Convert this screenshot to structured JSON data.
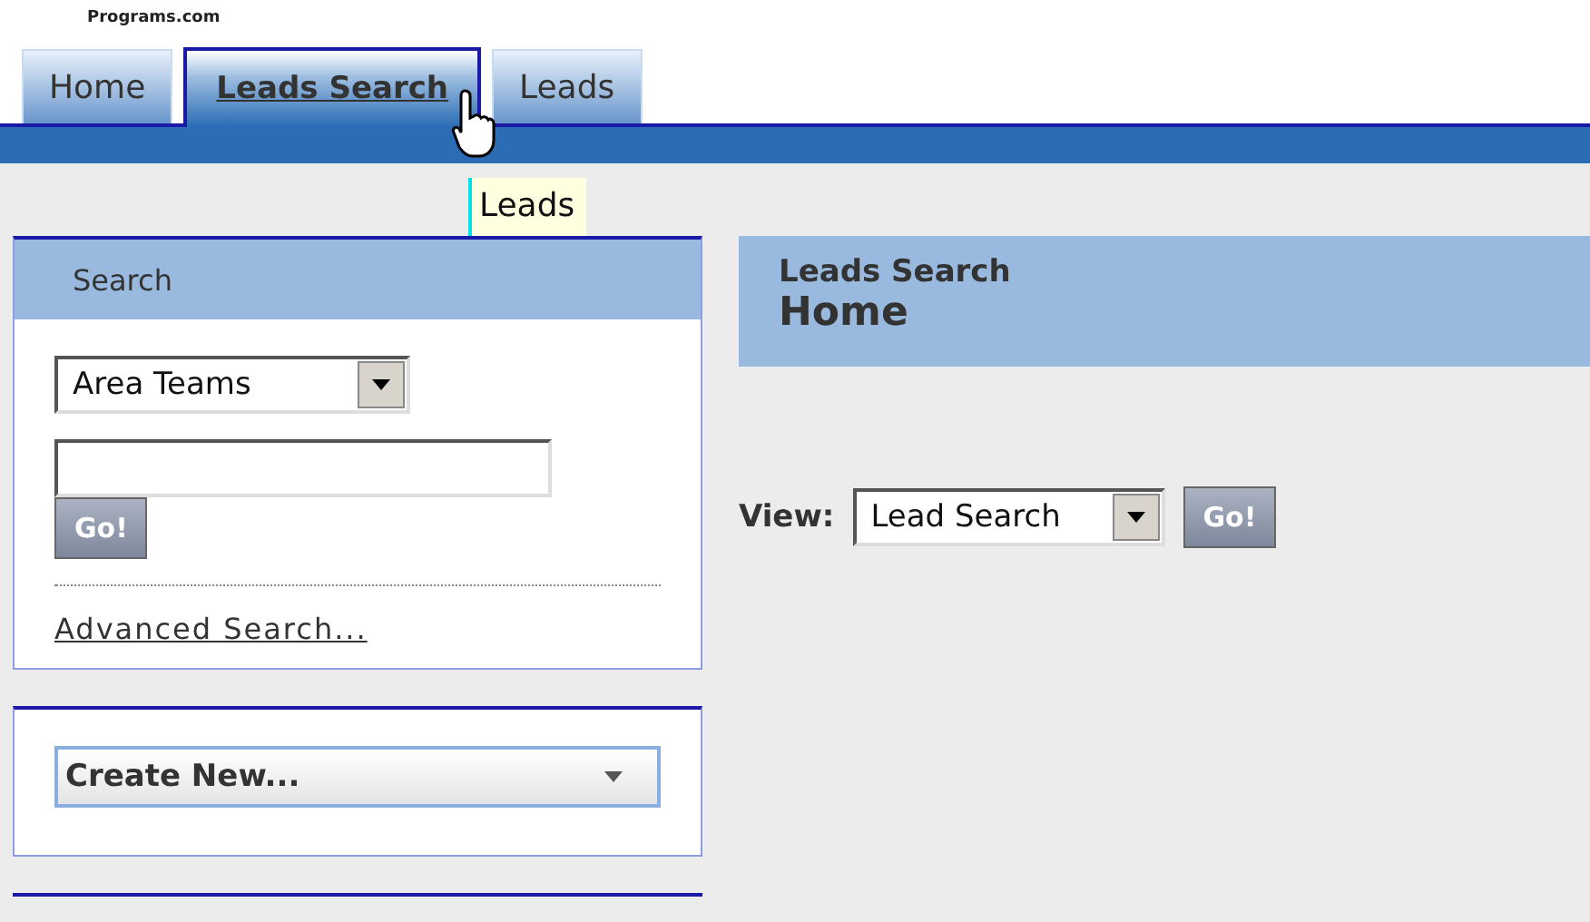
{
  "logo": {
    "text": "Programs.com"
  },
  "tabs": [
    {
      "label": "Home",
      "selected": false
    },
    {
      "label": "Leads Search",
      "selected": true
    },
    {
      "label": "Leads",
      "selected": false
    }
  ],
  "tooltip": {
    "text": "Leads"
  },
  "search_panel": {
    "title": "Search",
    "dropdown": {
      "value": "Area Teams"
    },
    "go_button": "Go!",
    "link": "Advanced Search..."
  },
  "create_panel": {
    "dropdown": {
      "value": "Create New..."
    }
  },
  "main": {
    "subtitle": "Leads Search",
    "title": "Home",
    "view_label": "View:",
    "view_dropdown": {
      "value": "Lead Search"
    },
    "go_button": "Go!"
  }
}
